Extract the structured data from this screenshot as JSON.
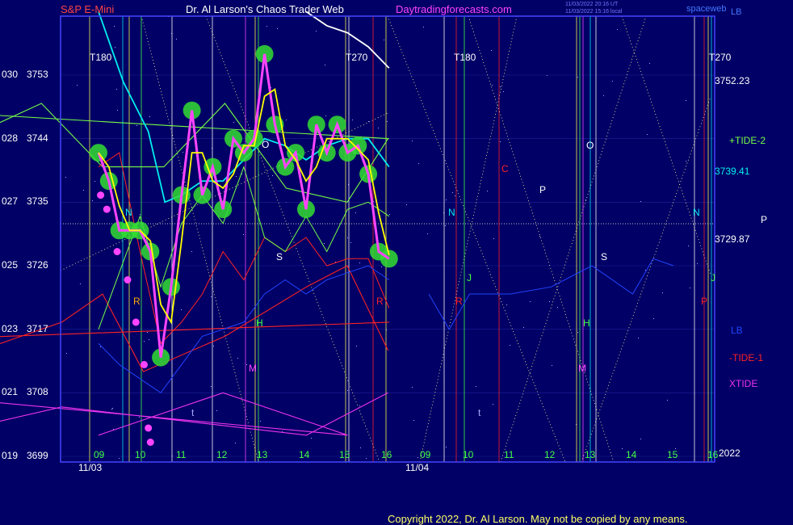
{
  "header": {
    "instrument": "S&P E-Mini",
    "title": "Dr. Al Larson's Chaos Trader Web",
    "site": "Daytradingforecasts.com",
    "timestamp_utc": "11/03/2022 20:16 UT",
    "timestamp_local": "11/03/2022 15:16 local",
    "logo": "spaceweb",
    "logo_suffix": "LB"
  },
  "colors": {
    "background": "#000066",
    "plot_frame": "#4444ff",
    "price_candles": "#ff44ff",
    "price_glow": "#33dd33",
    "yellow_avg": "#ffff00",
    "cyan_avg": "#00eeee",
    "tide_plus2": "#77ff44",
    "tide_minus1": "#ff2222",
    "xtide": "#ee33ee",
    "lb": "#2244ff",
    "white_curve": "#ffffff"
  },
  "chart_data": {
    "type": "line",
    "title": "S&P E-Mini",
    "y_axis": {
      "price_ticks": [
        3699,
        3708,
        3717,
        3726,
        3735,
        3744,
        3753
      ],
      "cycle_ticks": [
        "019",
        "021",
        "023",
        "025",
        "027",
        "028",
        "030"
      ],
      "ylim": [
        3699,
        3762
      ]
    },
    "x_axis": {
      "hour_ticks": [
        "09",
        "10",
        "11",
        "12",
        "13",
        "14",
        "15",
        "16",
        "09",
        "10",
        "11",
        "12",
        "13",
        "14",
        "15",
        "16"
      ],
      "dates": [
        "11/03",
        "11/04"
      ],
      "year": "2022"
    },
    "right_labels": {
      "price_high": "3752.23",
      "price_mid": "3739.41",
      "price_low": "3729.87",
      "plus_tide2": "+TIDE-2",
      "minus_tide1": "-TIDE-1",
      "xtide": "XTIDE",
      "lb": "LB",
      "p": "P"
    },
    "vertical_markers": [
      {
        "label": "T180",
        "x": 9.3
      },
      {
        "label": "T270",
        "x": 15.3
      },
      {
        "label": "T180",
        "x": 33.3
      },
      {
        "label": "T270",
        "x": 39.3
      }
    ],
    "letter_markers": [
      "N",
      "R",
      "J",
      "H",
      "M",
      "t",
      "O",
      "S",
      "N",
      "C",
      "P",
      "R",
      "J",
      "H",
      "M",
      "t",
      "O",
      "S",
      "N",
      "R",
      "P"
    ],
    "series": [
      {
        "name": "price",
        "x": [
          9.0,
          9.25,
          9.5,
          9.75,
          10.0,
          10.25,
          10.5,
          10.75,
          11.0,
          11.25,
          11.5,
          11.75,
          12.0,
          12.25,
          12.5,
          12.75,
          13.0,
          13.25,
          13.5,
          13.75,
          14.0,
          14.25,
          14.5,
          14.75,
          15.0,
          15.25,
          15.5,
          15.75,
          16.0
        ],
        "values": [
          3742,
          3738,
          3731,
          3731,
          3731,
          3728,
          3713,
          3723,
          3736,
          3748,
          3736,
          3740,
          3734,
          3744,
          3742,
          3744,
          3756,
          3746,
          3740,
          3742,
          3734,
          3746,
          3742,
          3746,
          3742,
          3743,
          3739,
          3728,
          3727
        ]
      },
      {
        "name": "+TIDE-2",
        "x": [
          16.0,
          17.5,
          19.0,
          20.5,
          22.0,
          23.5,
          25.0,
          26.5,
          28.0,
          29.5,
          31.0,
          32.0
        ],
        "values": [
          3744,
          3749,
          3744,
          3742,
          3745,
          3749,
          3740,
          3740,
          3749,
          3737,
          3735,
          3744
        ]
      },
      {
        "name": "-TIDE-1",
        "x": [
          16.0,
          18.0,
          20.0,
          22.0,
          24.0,
          25.0,
          26.0,
          28.0,
          30.0,
          31.0,
          32.0
        ],
        "values": [
          3718,
          3715,
          3717,
          3714,
          3718,
          3722,
          3711,
          3716,
          3723,
          3726,
          3714
        ]
      },
      {
        "name": "XTIDE",
        "x": [
          9.0,
          12.0,
          15.0,
          18.0,
          21.0,
          24.0,
          27.0,
          30.0,
          32.0
        ],
        "values": [
          3702,
          3708,
          3702,
          3709,
          3702,
          3706,
          3704,
          3702,
          3708
        ]
      }
    ]
  },
  "footer": {
    "copyright": "Copyright 2022, Dr. Al Larson. May not be copied by any means."
  }
}
